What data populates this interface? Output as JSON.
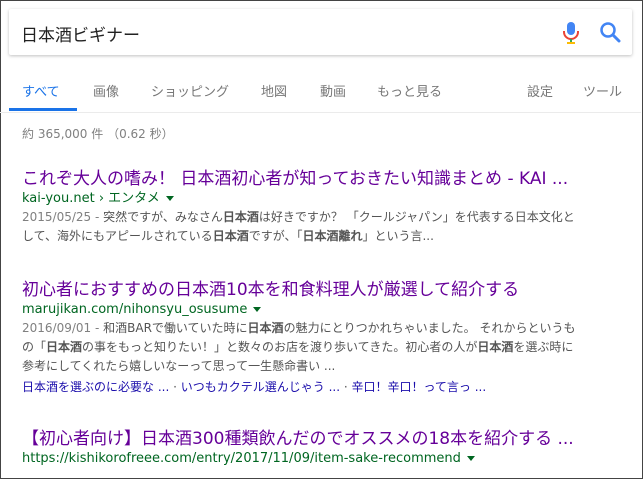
{
  "search": {
    "query": "日本酒ビギナー",
    "mic_icon": "microphone-icon",
    "search_icon": "magnifier-icon"
  },
  "tabs": {
    "items": [
      "すべて",
      "画像",
      "ショッピング",
      "地図",
      "動画",
      "もっと見る"
    ],
    "settings": "設定",
    "tools": "ツール",
    "active": "すべて"
  },
  "stats": "約 365,000 件 （0.62 秒）",
  "results": [
    {
      "title": "これぞ大人の嗜み！ 日本酒初心者が知っておきたい知識まとめ - KAI ...",
      "url": "kai-you.net › エンタメ",
      "date": "2015/05/25 - ",
      "snippet_line1_parts": [
        "突然ですが、みなさん",
        "日本酒",
        "は好きですか？ 「クールジャパン」を代表する日本文化と"
      ],
      "snippet_line2_parts": [
        "して、海外にもアピールされている",
        "日本酒",
        "ですが、「",
        "日本酒離れ",
        "」という言..."
      ]
    },
    {
      "title": "初心者におすすめの日本酒10本を和食料理人が厳選して紹介する",
      "url": "marujikan.com/nihonsyu_osusume",
      "date": "2016/09/01 - ",
      "snippet_line1_parts": [
        "和酒BARで働いていた時に",
        "日本酒",
        "の魅力にとりつかれちゃいました。 それからというも"
      ],
      "snippet_line2_parts": [
        "の「",
        "日本酒",
        "の事をもっと知りたい！」と数々のお店を渡り歩いてきた。初心者の人が",
        "日本酒",
        "を選ぶ時に"
      ],
      "snippet_line3": "参考にしてくれたら嬉しいなーって思って一生懸命書い ...",
      "sitelinks": [
        "日本酒を選ぶのに必要な ...",
        "いつもカクテル選んじゃう ...",
        "辛口！辛口！って言っ ..."
      ]
    },
    {
      "title": "【初心者向け】日本酒300種類飲んだのでオススメの18本を紹介する ...",
      "url": "https://kishikorofreee.com/entry/2017/11/09/item-sake-recommend"
    }
  ],
  "colors": {
    "accent": "#1a73e8",
    "title_visited": "#660099",
    "url": "#006621",
    "snippet": "#545454"
  }
}
